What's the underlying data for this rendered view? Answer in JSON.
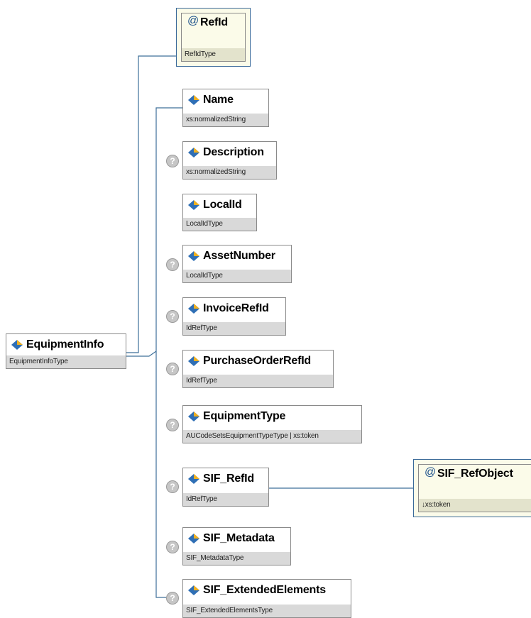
{
  "root": {
    "name": "EquipmentInfo",
    "type": "EquipmentInfoType",
    "icon": "element-icon"
  },
  "attribute": {
    "name": "RefId",
    "type": "RefIdType",
    "symbol": "@"
  },
  "qmark_symbol": "?",
  "elements": [
    {
      "key": "name",
      "name": "Name",
      "type": "xs:normalizedString",
      "optional": false
    },
    {
      "key": "description",
      "name": "Description",
      "type": "xs:normalizedString",
      "optional": true
    },
    {
      "key": "localid",
      "name": "LocalId",
      "type": "LocalIdType",
      "optional": false
    },
    {
      "key": "assetnumber",
      "name": "AssetNumber",
      "type": "LocalIdType",
      "optional": true
    },
    {
      "key": "invoicerefid",
      "name": "InvoiceRefId",
      "type": "IdRefType",
      "optional": true
    },
    {
      "key": "purchaseorderrefid",
      "name": "PurchaseOrderRefId",
      "type": "IdRefType",
      "optional": true
    },
    {
      "key": "equipmenttype",
      "name": "EquipmentType",
      "type": "AUCodeSetsEquipmentTypeType | xs:token",
      "optional": true
    },
    {
      "key": "sif-refid",
      "name": "SIF_RefId",
      "type": "IdRefType",
      "optional": true
    },
    {
      "key": "sif-metadata",
      "name": "SIF_Metadata",
      "type": "SIF_MetadataType",
      "optional": true
    },
    {
      "key": "sif-extendedelements",
      "name": "SIF_ExtendedElements",
      "type": "SIF_ExtendedElementsType",
      "optional": true
    }
  ],
  "sif_refobject": {
    "name": "SIF_RefObject",
    "type": "↓xs:token",
    "symbol": "@"
  }
}
